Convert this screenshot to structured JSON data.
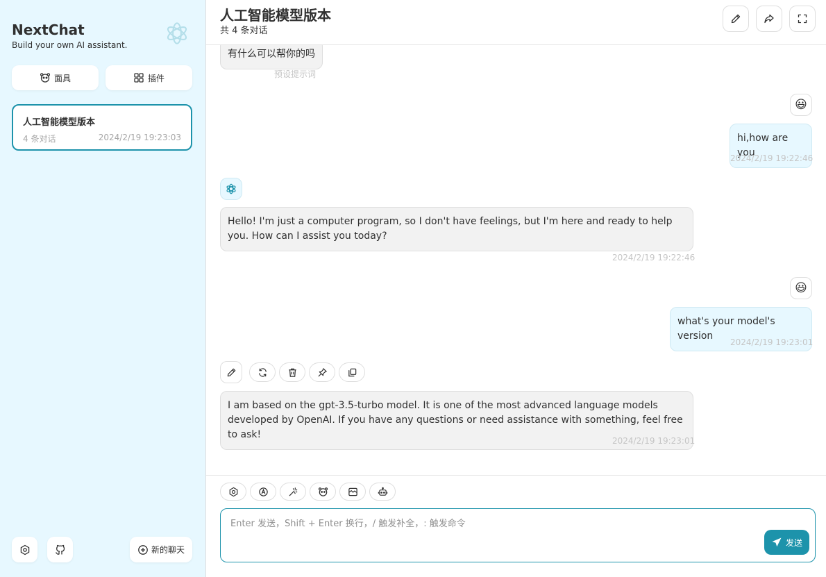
{
  "sidebar": {
    "brand_title": "NextChat",
    "brand_subtitle": "Build your own AI assistant.",
    "masks_label": "面具",
    "plugins_label": "插件",
    "chat_item": {
      "title": "人工智能模型版本",
      "count": "4 条对话",
      "date": "2024/2/19 19:23:03"
    },
    "new_chat_label": "新的聊天"
  },
  "header": {
    "title": "人工智能模型版本",
    "subtitle": "共 4 条对话"
  },
  "messages": [
    {
      "role": "bot",
      "text": "有什么可以帮你的吗",
      "time": "预设提示词"
    },
    {
      "role": "user",
      "avatar": "😃",
      "text": "hi,how are you",
      "time": "2024/2/19 19:22:46"
    },
    {
      "role": "bot",
      "text": "Hello! I'm just a computer program, so I don't have feelings, but I'm here and ready to help you. How can I assist you today?",
      "time": "2024/2/19 19:22:46"
    },
    {
      "role": "user",
      "avatar": "😃",
      "text": "what's your model's version",
      "time": "2024/2/19 19:23:01"
    },
    {
      "role": "bot",
      "text": "I am based on the gpt-3.5-turbo model. It is one of the most advanced language models developed by OpenAI. If you have any questions or need assistance with something, feel free to ask!",
      "time": "2024/2/19 19:23:01"
    }
  ],
  "input": {
    "placeholder": "Enter 发送，Shift + Enter 换行，/ 触发补全，: 触发命令",
    "value": "",
    "send_label": "发送"
  },
  "colors": {
    "accent": "#1d93ab",
    "sidebar_bg": "#e7f8ff",
    "user_bubble": "#e7f8ff",
    "bot_bubble": "#f2f2f2"
  },
  "icons": {
    "brand": "openai-logo-icon",
    "masks": "mask-icon",
    "plugins": "plugin-grid-icon",
    "settings": "settings-icon",
    "github": "github-icon",
    "new_chat": "add-circle-icon",
    "header_rename": "pencil-icon",
    "header_share": "share-icon",
    "header_fullscreen": "maximize-icon",
    "send": "send-icon"
  }
}
